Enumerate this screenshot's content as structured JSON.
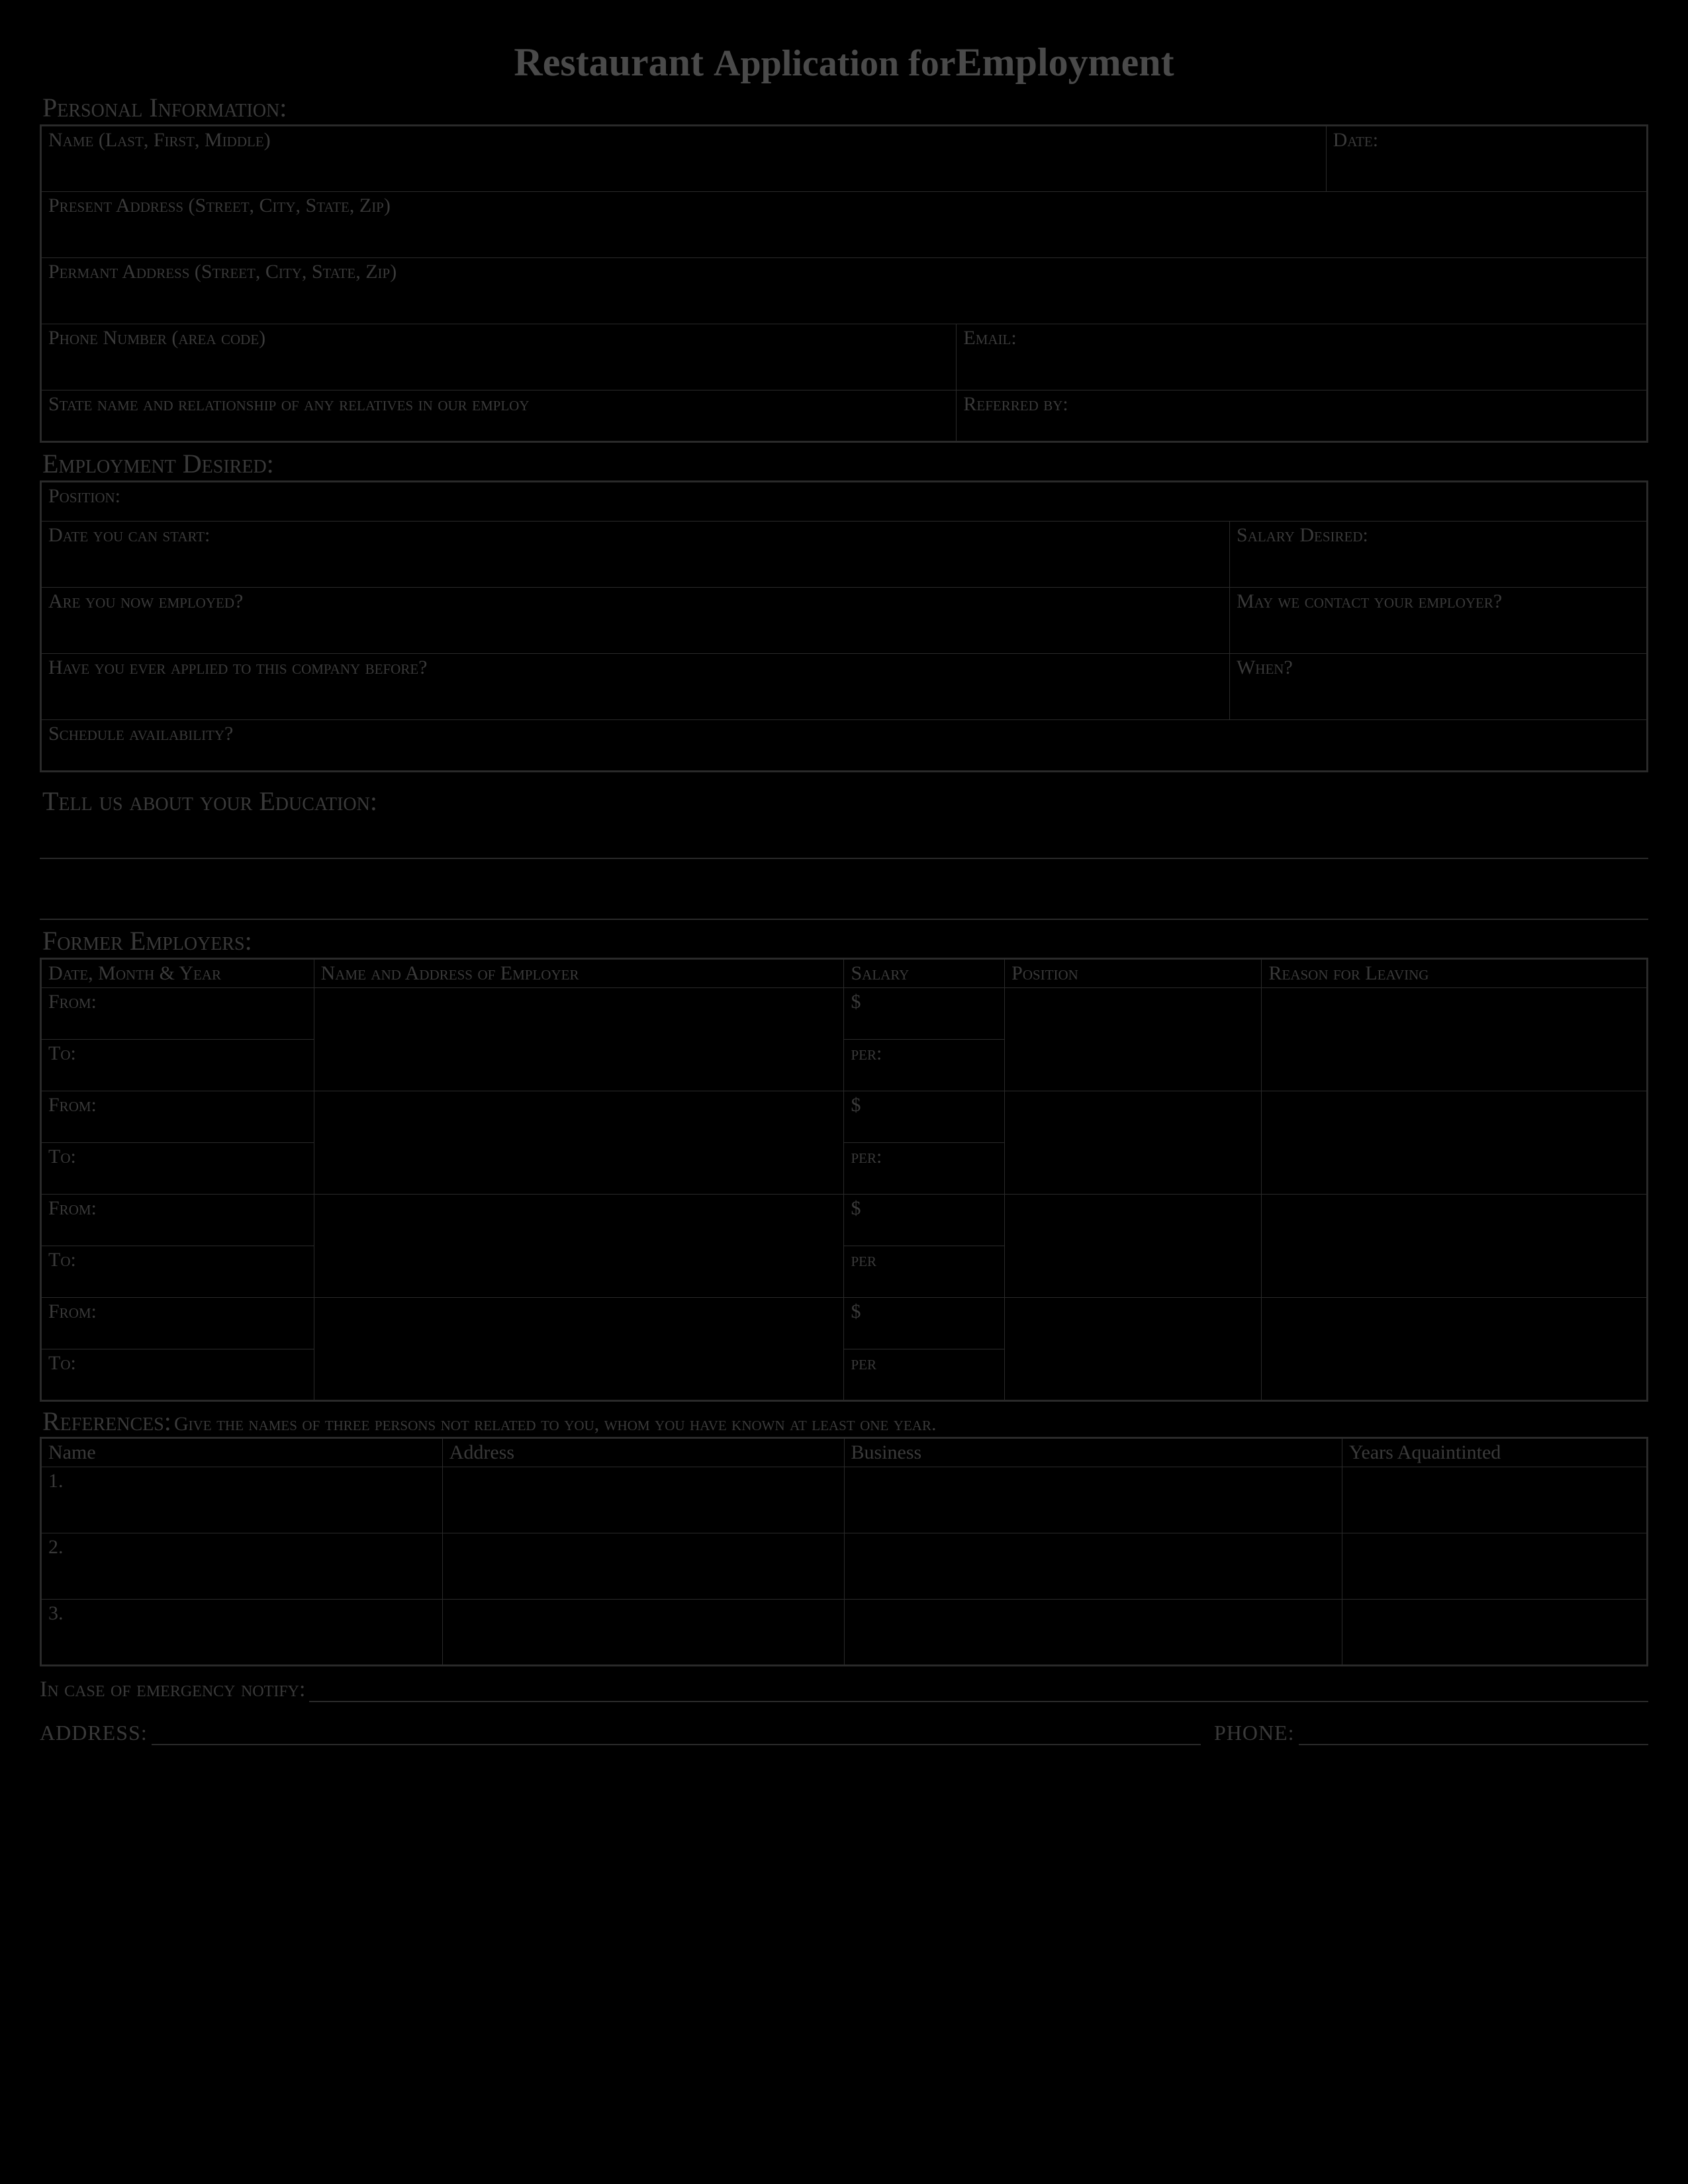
{
  "title_part1": "Restaurant ",
  "title_part2": "Application for",
  "title_part3": "Employment",
  "sections": {
    "personal": "Personal Information:",
    "employment": "Employment Desired:",
    "education": "Tell us about your Education:",
    "former": "Former Employers:",
    "references": "References:",
    "references_sub": " Give the names of three persons not related to you, whom you have known at least one year.",
    "emergency": "In case of emergency notify:",
    "address": "ADDRESS:",
    "phone": "PHONE:"
  },
  "personal": {
    "name": "Name (Last, First, Middle)",
    "date": "Date:",
    "present_addr": "Present Address (Street, City, State, Zip)",
    "perm_addr": "Permant Address (Street, City, State, Zip)",
    "phone": "Phone Number (area code)",
    "email": "Email:",
    "relatives": "State name and relationship of any relatives in our employ",
    "referred": "Referred by:"
  },
  "employment": {
    "position": "Position:",
    "start": "Date you can start:",
    "salary": "Salary Desired:",
    "employed": "Are you now employed?",
    "contact": "May we contact your employer?",
    "applied": "Have you ever applied to this company before?",
    "when": "When?",
    "schedule": "Schedule availability?"
  },
  "former_headers": {
    "date": "Date, Month & Year",
    "name": "Name and Address of Employer",
    "salary": "Salary",
    "position": "Position",
    "reason": "Reason for Leaving"
  },
  "former_labels": {
    "from": "From:",
    "to": "To:",
    "dollar": "$",
    "per": "per:",
    "per2": "per"
  },
  "ref_headers": {
    "name": "Name",
    "address": "Address",
    "business": "Business",
    "years": "Years Aquaintinted"
  },
  "ref_nums": {
    "r1": "1.",
    "r2": "2.",
    "r3": "3."
  }
}
